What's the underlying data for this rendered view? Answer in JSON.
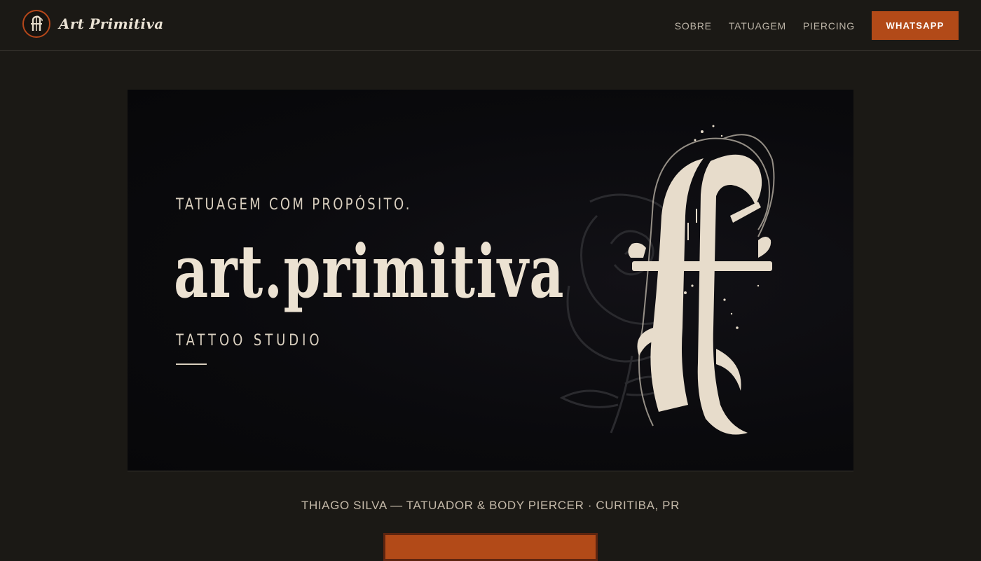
{
  "header": {
    "brand_name": "Art Primitiva",
    "logo_icon": "gothic-a-monogram-icon",
    "nav": [
      {
        "label": "SOBRE"
      },
      {
        "label": "TATUAGEM"
      },
      {
        "label": "PIERCING"
      }
    ],
    "cta_label": "WHATSAPP"
  },
  "hero": {
    "tagline": "TATUAGEM COM PROPÓSITO.",
    "title": "art.primitiva",
    "subtitle": "TATTOO STUDIO",
    "artwork_icon": "gothic-a-rose-artwork-icon"
  },
  "credit": "THIAGO SILVA — TATUADOR & BODY PIERCER · CURITIBA, PR",
  "colors": {
    "accent": "#b24a18",
    "background": "#1b1915",
    "hero_background": "#0a0a0d",
    "text_light": "#ece2d2"
  }
}
